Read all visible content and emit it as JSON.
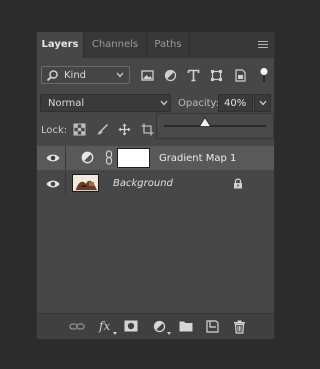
{
  "panel": {
    "tabs": [
      {
        "label": "Layers",
        "active": true
      },
      {
        "label": "Channels",
        "active": false
      },
      {
        "label": "Paths",
        "active": false
      }
    ]
  },
  "filter": {
    "kind_label": "Kind",
    "icons": [
      "image-filter-icon",
      "adjustment-filter-icon",
      "type-filter-icon",
      "shape-filter-icon",
      "smart-object-filter-icon",
      "filter-toggle-icon"
    ]
  },
  "blend": {
    "mode": "Normal",
    "opacity_label": "Opacity:",
    "opacity_value": "40%",
    "opacity_slider_fraction": 0.4
  },
  "lock": {
    "label": "Lock:",
    "icons": [
      "lock-transparent-pixels-icon",
      "lock-image-pixels-icon",
      "lock-position-icon",
      "lock-artboard-icon"
    ]
  },
  "layers": [
    {
      "name": "Gradient Map 1",
      "selected": true,
      "visible": true,
      "type": "adjustment"
    },
    {
      "name": "Background",
      "selected": false,
      "visible": true,
      "type": "background",
      "locked": true
    }
  ],
  "bottom_bar": {
    "fx_label": "fx",
    "icons": [
      "link-layers-icon",
      "layer-style-icon",
      "add-mask-icon",
      "new-adjustment-layer-icon",
      "new-group-icon",
      "new-layer-icon",
      "delete-layer-icon"
    ]
  },
  "colors": {
    "panel_bg": "#474747",
    "tabbar_bg": "#383838",
    "selected_row": "#595959",
    "app_bg": "#2c2c2c"
  }
}
